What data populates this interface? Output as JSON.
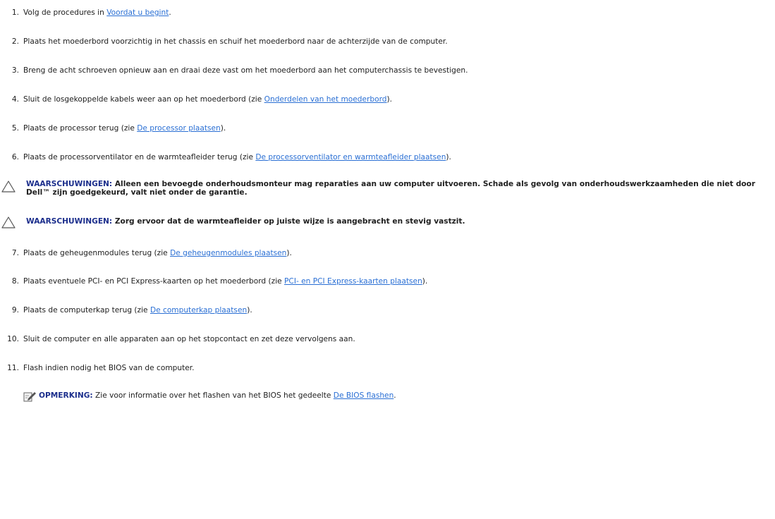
{
  "steps": [
    {
      "num": "1.",
      "before": "Volg de procedures in ",
      "link": "Voordat u begint",
      "after": "."
    },
    {
      "num": "2.",
      "text": "Plaats het moederbord voorzichtig in het chassis en schuif het moederbord naar de achterzijde van de computer."
    },
    {
      "num": "3.",
      "text": "Breng de acht schroeven opnieuw aan en draai deze vast om het moederbord aan het computerchassis te bevestigen."
    },
    {
      "num": "4.",
      "before": "Sluit de losgekoppelde kabels weer aan op het moederbord (zie ",
      "link": "Onderdelen van het moederbord",
      "after": ")."
    },
    {
      "num": "5.",
      "before": "Plaats de processor terug (zie ",
      "link": "De processor plaatsen",
      "after": ")."
    },
    {
      "num": "6.",
      "before": "Plaats de processorventilator en de warmteafleider terug (zie ",
      "link": "De processorventilator en warmteafleider plaatsen",
      "after": ")."
    },
    {
      "num": "7.",
      "before": "Plaats de geheugenmodules terug (zie ",
      "link": "De geheugenmodules plaatsen",
      "after": ")."
    },
    {
      "num": "8.",
      "before": "Plaats eventuele PCI- en PCI Express-kaarten op het moederbord (zie ",
      "link": "PCI- en PCI Express-kaarten plaatsen",
      "after": ")."
    },
    {
      "num": "9.",
      "before": "Plaats de computerkap terug (zie ",
      "link": "De computerkap plaatsen",
      "after": ")."
    },
    {
      "num": "10.",
      "text": "Sluit de computer en alle apparaten aan op het stopcontact en zet deze vervolgens aan."
    },
    {
      "num": "11.",
      "text": "Flash indien nodig het BIOS van de computer."
    }
  ],
  "warnings": [
    {
      "label": "WAARSCHUWINGEN:",
      "text": " Alleen een bevoegde onderhoudsmonteur mag reparaties aan uw computer uitvoeren. Schade als gevolg van onderhoudswerkzaamheden die niet door Dell™ zijn goedgekeurd, valt niet onder de garantie."
    },
    {
      "label": "WAARSCHUWINGEN:",
      "text": " Zorg ervoor dat de warmteafleider op juiste wijze is aangebracht en stevig vastzit."
    }
  ],
  "note": {
    "label": "OPMERKING:",
    "before": " Zie voor informatie over het flashen van het BIOS het gedeelte ",
    "link": "De BIOS flashen",
    "after": "."
  },
  "colors": {
    "link": "#2a6fd4",
    "warning_label": "#1b2e8c",
    "text": "#202020"
  },
  "icons": {
    "warning": "caution-triangle-icon",
    "note": "pencil-note-icon"
  }
}
